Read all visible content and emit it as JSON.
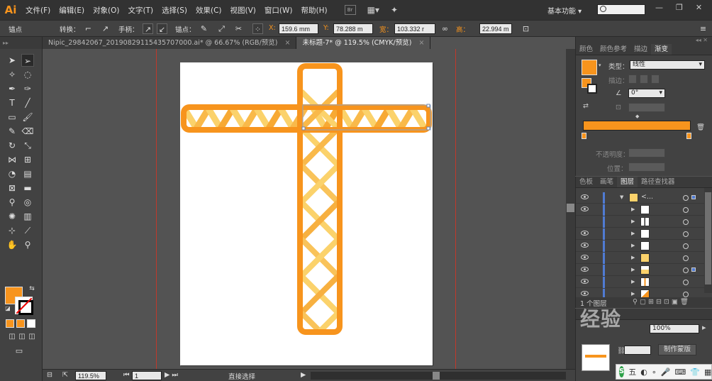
{
  "app": {
    "logo": "Ai"
  },
  "menu": [
    "文件(F)",
    "编辑(E)",
    "对象(O)",
    "文字(T)",
    "选择(S)",
    "效果(C)",
    "视图(V)",
    "窗口(W)",
    "帮助(H)"
  ],
  "menu_extra": {
    "bridge": "Br"
  },
  "workspace": "基本功能",
  "control": {
    "mode": "锚点",
    "convert": "转换：",
    "handles": "手柄：",
    "anchors": "锚点：",
    "x_label": "X:",
    "x": "159.6 mm",
    "y_label": "Y:",
    "y": "78.288 m",
    "w_label": "宽：",
    "w": "103.332 r",
    "h_label": "高：",
    "h": "22.994 m"
  },
  "tabs": [
    {
      "label": "Nipic_29842067_20190829115435707000.ai* @ 66.67% (RGB/预览)",
      "close": "×"
    },
    {
      "label": "未标题-7* @ 119.5% (CMYK/预览)",
      "close": "×"
    }
  ],
  "status": {
    "zoom": "119.5%",
    "page": "1",
    "tool": "直接选择"
  },
  "gradient_panel": {
    "tabs": [
      "颜色",
      "颜色参考",
      "描边",
      "渐变"
    ],
    "type_label": "类型：",
    "type_value": "线性",
    "stroke_label": "描边：",
    "angle_value": "0°",
    "opacity_label": "不透明度：",
    "position_label": "位置："
  },
  "layers_panel": {
    "tabs": [
      "色板",
      "画笔",
      "图层",
      "路径查找器"
    ],
    "parent_label": "<...",
    "footer_count": "1 个图层"
  },
  "lower_panel": {
    "opacity_value": "100%",
    "make_mask": "制作蒙版",
    "watermark": "经验"
  },
  "ime": {
    "logo": "S",
    "mode": "五"
  },
  "colors": {
    "accent": "#f7941d",
    "light": "#fbd26b",
    "chrome": "#424242"
  }
}
